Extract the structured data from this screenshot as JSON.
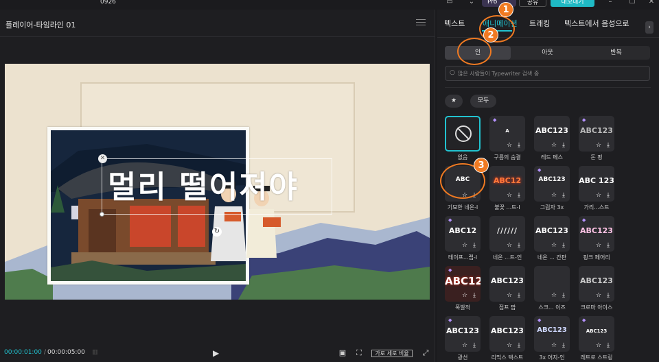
{
  "app": {
    "project_name": "0926",
    "pro_label": "Pro",
    "share_label": "공유",
    "export_label": "내보내기"
  },
  "player": {
    "title": "플레이어-타임라인 01",
    "canvas_text": "멀리 떨어져야",
    "time_current": "00:00:01:00",
    "time_separator": "/",
    "time_total": "00:00:05:00",
    "ratio_label": "가로 세로 비율"
  },
  "side": {
    "tabs": [
      {
        "label": "텍스트",
        "active": false
      },
      {
        "label": "애니메이션",
        "active": true
      },
      {
        "label": "트래킹",
        "active": false
      },
      {
        "label": "텍스트에서 음성으로",
        "active": false
      }
    ],
    "segments": [
      {
        "label": "인",
        "active": true
      },
      {
        "label": "아웃",
        "active": false
      },
      {
        "label": "반복",
        "active": false
      }
    ],
    "search_placeholder": "많은 사람들이 Typewriter 검색 중",
    "filter_all": "모두",
    "effects": [
      {
        "label": "없음",
        "sample": "",
        "pro": false,
        "none": true,
        "selected": true
      },
      {
        "label": "구름의 숨결",
        "sample": "A",
        "pro": true
      },
      {
        "label": "레드 페스",
        "sample": "ABC123",
        "pro": false
      },
      {
        "label": "돈 펑",
        "sample": "ABC123",
        "pro": true
      },
      {
        "label": "기묘한 네온-I",
        "sample": "ABC",
        "pro": false
      },
      {
        "label": "불꽃 ...트-I",
        "sample": "ABC12",
        "pro": false
      },
      {
        "label": "그림자 3x",
        "sample": "ABC123",
        "pro": true
      },
      {
        "label": "가리...스트",
        "sample": "ABC 123",
        "pro": false
      },
      {
        "label": "테이프...랩-I",
        "sample": "ABC12",
        "pro": true
      },
      {
        "label": "네온 ...트-인",
        "sample": "//////",
        "pro": false
      },
      {
        "label": "네온 ... 간판",
        "sample": "ABC123",
        "pro": false
      },
      {
        "label": "핑크 페어리",
        "sample": "ABC123",
        "pro": true
      },
      {
        "label": "폭발적",
        "sample": "ABC12",
        "pro": true
      },
      {
        "label": "점프 팝",
        "sample": "ABC123",
        "pro": false
      },
      {
        "label": "스크... 이즈",
        "sample": "",
        "pro": false
      },
      {
        "label": "크로마 아이스",
        "sample": "ABC123",
        "pro": false
      },
      {
        "label": "광선",
        "sample": "ABC123",
        "pro": true
      },
      {
        "label": "리믹스 텍스트",
        "sample": "ABC123",
        "pro": false
      },
      {
        "label": "3x 어지-인",
        "sample": "ABC123",
        "pro": true
      },
      {
        "label": "레트로 스트링",
        "sample": "ABC123",
        "pro": true
      }
    ]
  },
  "annotations": [
    {
      "number": "1"
    },
    {
      "number": "2"
    },
    {
      "number": "3"
    }
  ],
  "colors": {
    "accent": "#22c3d0",
    "marker": "#f07a22",
    "pro_gem": "#b592ff"
  }
}
